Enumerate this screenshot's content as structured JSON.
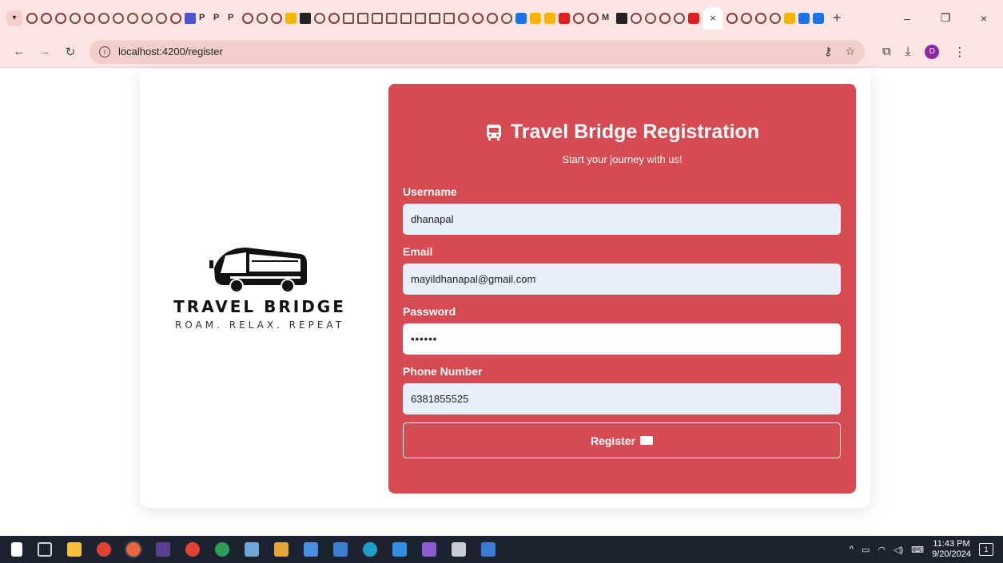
{
  "browser": {
    "tab_menu_icon": "chevron-down-icon",
    "active_tab_close": "×",
    "new_tab": "+",
    "window_controls": {
      "minimize": "–",
      "restore": "❐",
      "close": "×"
    },
    "url": "localhost:4200/register",
    "profile_initial": "D"
  },
  "page": {
    "brand_name": "TRAVEL BRIDGE",
    "tagline": "ROAM. RELAX. REPEAT",
    "form": {
      "title": "Travel Bridge Registration",
      "subtitle": "Start your journey with us!",
      "fields": {
        "username": {
          "label": "Username",
          "value": "dhanapal"
        },
        "email": {
          "label": "Email",
          "value": "mayildhanapal@gmail.com"
        },
        "password": {
          "label": "Password",
          "value": "••••••"
        },
        "phone": {
          "label": "Phone Number",
          "value": "6381855525"
        }
      },
      "submit_label": "Register"
    },
    "colors": {
      "card": "#d64a52",
      "input_bg": "#e7f0fb"
    }
  },
  "taskbar": {
    "time": "11:43 PM",
    "date": "9/20/2024",
    "notification_count": "1"
  }
}
